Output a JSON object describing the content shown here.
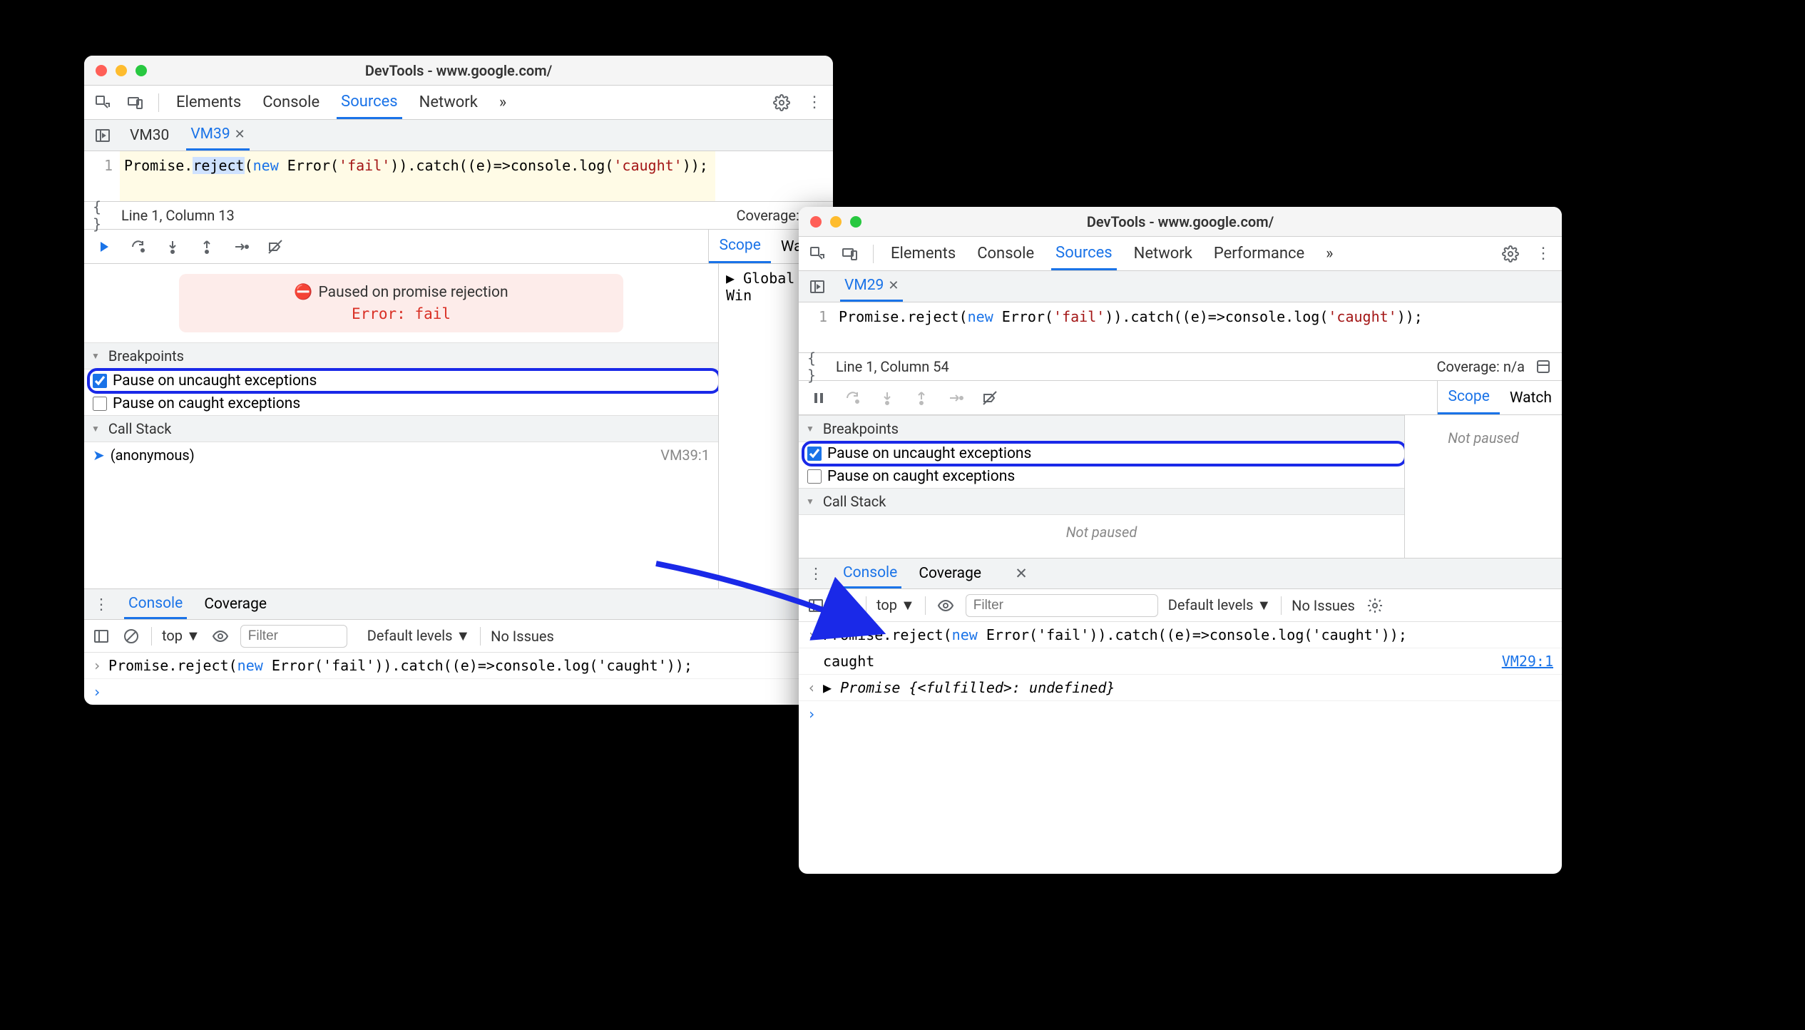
{
  "windows": {
    "left": {
      "title": "DevTools - www.google.com/",
      "main_tabs": [
        "Elements",
        "Console",
        "Sources",
        "Network"
      ],
      "active_main_tab": "Sources",
      "overflow_glyph": "»",
      "file_tabs": {
        "inactive": "VM30",
        "active": "VM39"
      },
      "code": {
        "line_no": "1",
        "text": "Promise.reject(new Error('fail')).catch((e)=>console.log('caught'));",
        "tokens": {
          "pre": "Promise.",
          "sel": "reject",
          "mid1": "(",
          "new": "new",
          "mid2": " Error(",
          "s1": "'fail'",
          "mid3": ")).catch((e)=>console.log(",
          "s2": "'caught'",
          "mid4": "));"
        }
      },
      "status": {
        "pos": "Line 1, Column 13",
        "coverage": "Coverage: n/a"
      },
      "side_tabs": [
        "Scope",
        "Watch"
      ],
      "active_side_tab": "Scope",
      "scope_row": "▶ Global    Win",
      "pause_banner": {
        "title": "Paused on promise rejection",
        "msg": "Error: fail"
      },
      "breakpoints": {
        "header": "Breakpoints",
        "uncaught": {
          "label": "Pause on uncaught exceptions",
          "checked": true
        },
        "caught": {
          "label": "Pause on caught exceptions",
          "checked": false
        }
      },
      "callstack": {
        "header": "Call Stack",
        "frame": "(anonymous)",
        "loc": "VM39:1"
      },
      "console": {
        "tabs": [
          "Console",
          "Coverage"
        ],
        "active_tab": "Console",
        "context": "top",
        "filter_placeholder": "Filter",
        "levels": "Default levels",
        "issues": "No Issues",
        "input": "Promise.reject(new Error('fail')).catch((e)=>console.log('caught'));"
      }
    },
    "right": {
      "title": "DevTools - www.google.com/",
      "main_tabs": [
        "Elements",
        "Console",
        "Sources",
        "Network",
        "Performance"
      ],
      "active_main_tab": "Sources",
      "overflow_glyph": "»",
      "file_tabs": {
        "active": "VM29"
      },
      "code": {
        "line_no": "1",
        "text": "Promise.reject(new Error('fail')).catch((e)=>console.log('caught'));",
        "tokens": {
          "pre": "Promise.reject(",
          "new": "new",
          "mid2": " Error(",
          "s1": "'fail'",
          "mid3": ")).catch((e)=>console.log(",
          "s2": "'caught'",
          "mid4": "));"
        }
      },
      "status": {
        "pos": "Line 1, Column 54",
        "coverage": "Coverage: n/a"
      },
      "side_tabs": [
        "Scope",
        "Watch"
      ],
      "active_side_tab": "Scope",
      "not_paused": "Not paused",
      "breakpoints": {
        "header": "Breakpoints",
        "uncaught": {
          "label": "Pause on uncaught exceptions",
          "checked": true
        },
        "caught": {
          "label": "Pause on caught exceptions",
          "checked": false
        }
      },
      "callstack": {
        "header": "Call Stack",
        "not_paused": "Not paused"
      },
      "console": {
        "tabs": [
          "Console",
          "Coverage"
        ],
        "active_tab": "Console",
        "context": "top",
        "filter_placeholder": "Filter",
        "levels": "Default levels",
        "issues": "No Issues",
        "lines": {
          "input": "Promise.reject(new Error('fail')).catch((e)=>console.log('caught'));",
          "log": "caught",
          "log_src": "VM29:1",
          "result_prefix": "▶ ",
          "result_italic": "Promise {<fulfilled>: undefined}"
        }
      }
    }
  }
}
